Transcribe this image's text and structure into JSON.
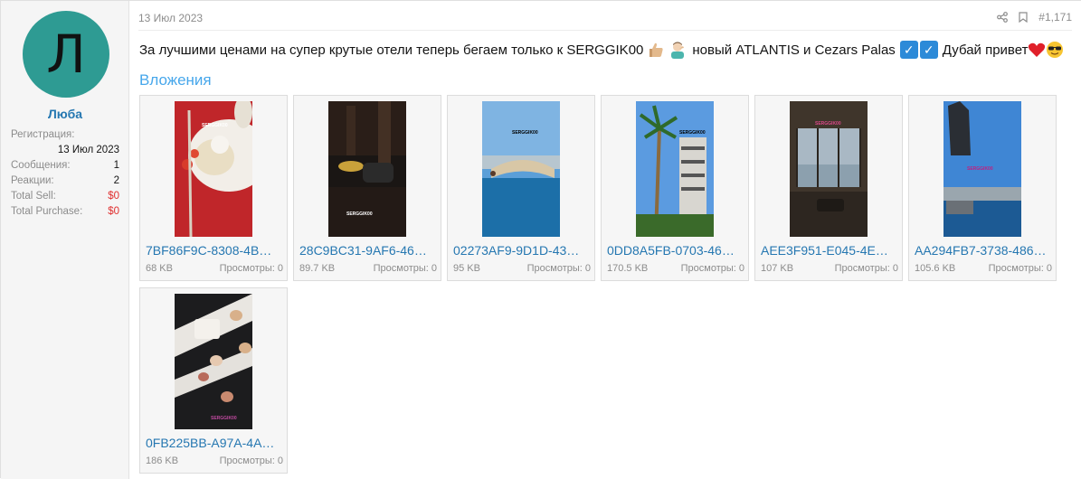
{
  "user": {
    "avatar_letter": "Л",
    "avatar_color": "#2e9b93",
    "name": "Люба",
    "registration_label": "Регистрация:",
    "registration_date": "13 Июл 2023",
    "messages_label": "Сообщения:",
    "messages_value": "1",
    "reactions_label": "Реакции:",
    "reactions_value": "2",
    "total_sell_label": "Total Sell:",
    "total_sell_value": "$0",
    "total_purchase_label": "Total Purchase:",
    "total_purchase_value": "$0"
  },
  "post": {
    "date": "13 Июл 2023",
    "number": "#1,171",
    "share_icon": "share-icon",
    "bookmark_icon": "bookmark-icon",
    "text_part1": "За лучшими ценами на супер крутые отели теперь бегаем только к SERGGIK00",
    "text_part2": "новый ATLANTIS и Cezars Palas",
    "text_part3": "Дубай привет",
    "check_mark": "✓"
  },
  "attachments": {
    "title": "Вложения",
    "views_label": "Просмотры:",
    "items": [
      {
        "name": "7BF86F9C-8308-4B…",
        "size": "68 KB",
        "views": "0"
      },
      {
        "name": "28C9BC31-9AF6-46…",
        "size": "89.7 KB",
        "views": "0"
      },
      {
        "name": "02273AF9-9D1D-43…",
        "size": "95 KB",
        "views": "0"
      },
      {
        "name": "0DD8A5FB-0703-46…",
        "size": "170.5 KB",
        "views": "0"
      },
      {
        "name": "AEE3F951-E045-4E…",
        "size": "107 KB",
        "views": "0"
      },
      {
        "name": "AA294FB7-3738-486…",
        "size": "105.6 KB",
        "views": "0"
      },
      {
        "name": "0FB225BB-A97A-4A…",
        "size": "186 KB",
        "views": "0"
      }
    ],
    "watermark": "SERGGIK00"
  },
  "colors": {
    "link": "#2577b1",
    "title": "#47a7eb",
    "muted": "#8c8c8c",
    "negative": "#e03030"
  }
}
